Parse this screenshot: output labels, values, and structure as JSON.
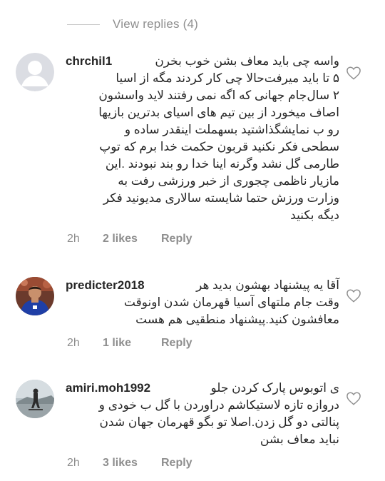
{
  "view_replies": "View replies (4)",
  "comments": [
    {
      "username": "chrchil1",
      "first_line": "واسه چی باید معاف بشن خوب بخرن",
      "lines": [
        "۵ تا باید میرفت‌حالا چی کار کردند مگه از اسیا",
        "۲ سال‌جام جهانی که اگه نمی رفتند لاید واسشون",
        "اصاف میخورد از بین تیم های اسیای بدترین بازیها",
        "رو ب نمایشگذاشتید بسهملت اینقدر ساده و",
        "سطحی فکر نکنید قربون حکمت خدا برم که توپ",
        "طارمی گل نشد وگرنه اینا خدا رو بند نبودند .این",
        "مازیار ناظمی چجوری از خبر ورزشی رفت به",
        "وزارت ورزش حتما شایسته سالاری مدیونید فکر",
        "دیگه بکنید"
      ],
      "time": "2h",
      "likes": "2 likes",
      "reply": "Reply",
      "avatar_icon": "default-avatar-icon"
    },
    {
      "username": "predicter2018",
      "first_line": "آقا یه پیشنهاد بهشون بدید هر",
      "lines": [
        "وقت جام ملتهای آسیا قهرمان شدن اونوقت",
        "معافشون کنید.پیشنهاد منطقیی هم هست"
      ],
      "time": "2h",
      "likes": "1 like",
      "reply": "Reply",
      "avatar_icon": "soccer-player-avatar"
    },
    {
      "username": "amiri.moh1992",
      "first_line": "ی اتوبوس پارک کردن جلو",
      "lines": [
        "دروازه تازه لاستیکاشم دراوردن با گل ب خودی و",
        "پنالتی دو گل زدن.اصلا تو بگو قهرمان جهان شدن",
        "نباید معاف بشن"
      ],
      "time": "2h",
      "likes": "3 likes",
      "reply": "Reply",
      "avatar_icon": "skater-avatar"
    }
  ],
  "colors": {
    "text": "#262626",
    "muted": "#8e8e8e",
    "divider": "#c7c7c7",
    "background": "#ffffff"
  }
}
